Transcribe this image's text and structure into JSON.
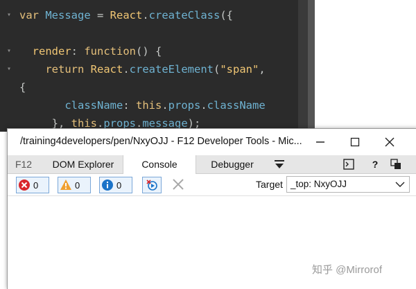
{
  "editor": {
    "lines": [
      {
        "fold": "▾",
        "parts": [
          {
            "t": "var ",
            "c": "kw"
          },
          {
            "t": "Message ",
            "c": "id"
          },
          {
            "t": "= ",
            "c": "txt"
          },
          {
            "t": "React",
            "c": "str"
          },
          {
            "t": ".",
            "c": "txt"
          },
          {
            "t": "createClass",
            "c": "id"
          },
          {
            "t": "({",
            "c": "txt"
          }
        ]
      },
      {
        "fold": "",
        "parts": []
      },
      {
        "fold": "▾",
        "parts": [
          {
            "t": "  render",
            "c": "str"
          },
          {
            "t": ": ",
            "c": "txt"
          },
          {
            "t": "function",
            "c": "kw"
          },
          {
            "t": "() {",
            "c": "txt"
          }
        ]
      },
      {
        "fold": "▾",
        "parts": [
          {
            "t": "    return ",
            "c": "kw"
          },
          {
            "t": "React",
            "c": "str"
          },
          {
            "t": ".",
            "c": "txt"
          },
          {
            "t": "createElement",
            "c": "id"
          },
          {
            "t": "(",
            "c": "txt"
          },
          {
            "t": "\"span\"",
            "c": "str"
          },
          {
            "t": ",",
            "c": "txt"
          }
        ]
      },
      {
        "fold": "",
        "parts": [
          {
            "t": "{",
            "c": "txt"
          }
        ]
      },
      {
        "fold": "",
        "parts": [
          {
            "t": "       className",
            "c": "id"
          },
          {
            "t": ": ",
            "c": "txt"
          },
          {
            "t": "this",
            "c": "kw"
          },
          {
            "t": ".",
            "c": "txt"
          },
          {
            "t": "props",
            "c": "id"
          },
          {
            "t": ".",
            "c": "txt"
          },
          {
            "t": "className",
            "c": "id"
          }
        ]
      },
      {
        "fold": "",
        "parts": [
          {
            "t": "     }, ",
            "c": "txt"
          },
          {
            "t": "this",
            "c": "kw"
          },
          {
            "t": ".",
            "c": "txt"
          },
          {
            "t": "props",
            "c": "id"
          },
          {
            "t": ".",
            "c": "txt"
          },
          {
            "t": "message",
            "c": "id"
          },
          {
            "t": ");",
            "c": "txt"
          }
        ]
      }
    ]
  },
  "window": {
    "title": "/training4developers/pen/NxyOJJ - F12 Developer Tools - Mic...",
    "minimize_icon": "minimize-icon",
    "maximize_icon": "maximize-icon",
    "close_icon": "close-icon"
  },
  "tabs": {
    "f12": "F12",
    "dom_explorer": "DOM Explorer",
    "console": "Console",
    "debugger": "Debugger",
    "active": "Console"
  },
  "toolbar": {
    "errors": "0",
    "warnings": "0",
    "messages": "0",
    "target_label": "Target",
    "target_value": "_top: NxyOJJ"
  },
  "colors": {
    "error": "#d9262c",
    "warning": "#f0a030",
    "info": "#1a73c8",
    "accent": "#7aa7d8"
  },
  "watermark": "知乎 @Mirrorof"
}
